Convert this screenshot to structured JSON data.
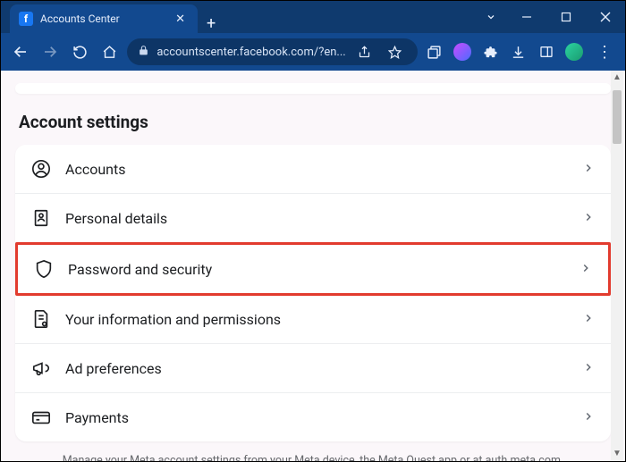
{
  "window": {
    "tab_title": "Accounts Center"
  },
  "addressbar": {
    "url": "accountscenter.facebook.com/?en..."
  },
  "page": {
    "section_title": "Account settings",
    "rows": {
      "accounts": "Accounts",
      "personal": "Personal details",
      "password": "Password and security",
      "info_perm": "Your information and permissions",
      "ad_pref": "Ad preferences",
      "payments": "Payments"
    },
    "footer": "Manage your Meta account settings from your Meta device, the Meta Quest app or at auth.meta.com."
  }
}
